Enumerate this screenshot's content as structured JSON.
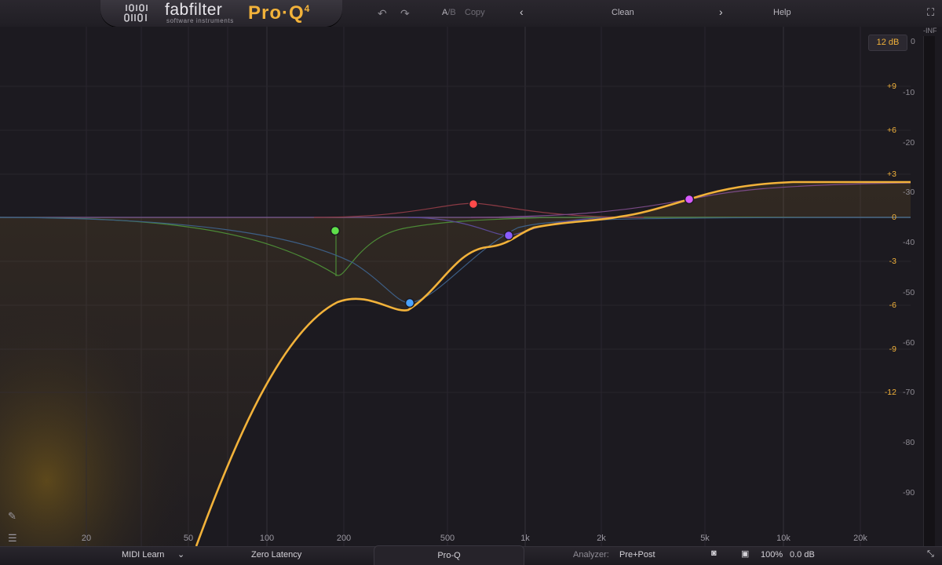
{
  "brand": {
    "name": "fabfilter",
    "tagline": "software instruments",
    "product": "Pro·Q",
    "version": "4"
  },
  "toolbar": {
    "undo_icon": "undo-icon",
    "redo_icon": "redo-icon",
    "ab_a": "A",
    "ab_b": "/B",
    "copy": "Copy",
    "prev_icon": "chevron-left-icon",
    "preset": "Clean",
    "next_icon": "chevron-right-icon",
    "help": "Help",
    "fullscreen_icon": "fullscreen-icon"
  },
  "display": {
    "scale": "12 dB",
    "gain_labels": [
      "+9",
      "+6",
      "+3",
      "0",
      "-3",
      "-6",
      "-9",
      "-12"
    ],
    "analyzer_labels": [
      "0",
      "-10",
      "-20",
      "-30",
      "-40",
      "-50",
      "-60",
      "-70",
      "-80",
      "-90"
    ],
    "meter_label": "-INF",
    "freq_labels": [
      "20",
      "50",
      "100",
      "200",
      "500",
      "1k",
      "2k",
      "5k",
      "10k",
      "20k"
    ]
  },
  "bands": [
    {
      "name": "band-1",
      "type": "low-cut",
      "color": "#5fe04a",
      "freq_hz": 190
    },
    {
      "name": "band-2",
      "type": "bell",
      "color": "#4aa3ff",
      "freq_hz": 365,
      "gain_db": -6.5
    },
    {
      "name": "band-3",
      "type": "bell",
      "color": "#ff4a4a",
      "freq_hz": 640,
      "gain_db": 1.0
    },
    {
      "name": "band-4",
      "type": "bell",
      "color": "#8a5cff",
      "freq_hz": 870,
      "gain_db": -1.5
    },
    {
      "name": "band-5",
      "type": "high-shelf",
      "color": "#d85cff",
      "freq_hz": 4300,
      "gain_db": 1.2
    }
  ],
  "colors": {
    "accent": "#f2b23a",
    "background": "#1c1a20"
  },
  "bottombar": {
    "midi_learn": "MIDI Learn",
    "midi_dropdown_icon": "chevron-down-icon",
    "latency": "Zero Latency",
    "tab": "Pro-Q",
    "analyzer_label": "Analyzer:",
    "analyzer_value": "Pre+Post",
    "zoom": "100%",
    "output_gain": "0.0 dB",
    "resize_icon": "resize-icon"
  },
  "side_tools": {
    "brush_icon": "brush-icon",
    "piano_icon": "piano-icon"
  }
}
